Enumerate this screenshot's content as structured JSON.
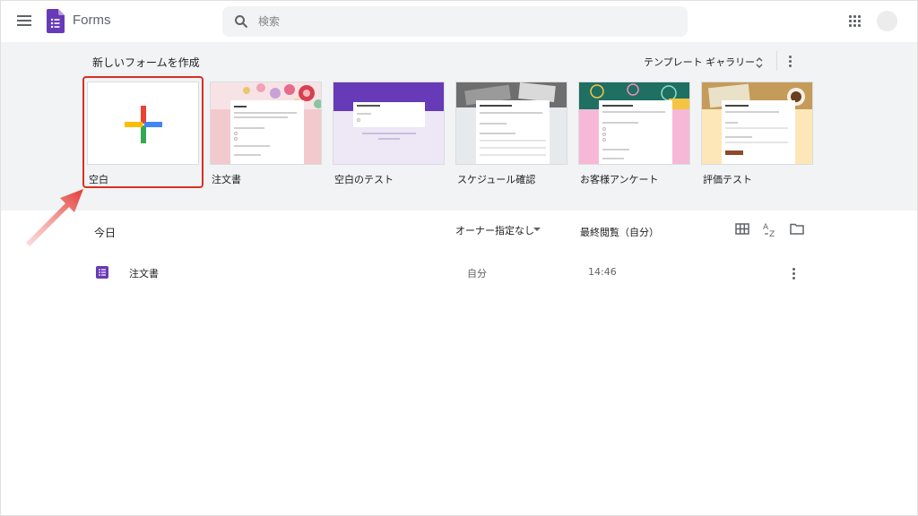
{
  "header": {
    "app_title": "Forms",
    "search_placeholder": "検索"
  },
  "templates": {
    "heading": "新しいフォームを作成",
    "gallery_label": "テンプレート ギャラリー",
    "items": [
      {
        "label": "空白"
      },
      {
        "label": "注文書"
      },
      {
        "label": "空白のテスト"
      },
      {
        "label": "スケジュール確認"
      },
      {
        "label": "お客様アンケート"
      },
      {
        "label": "評価テスト"
      }
    ]
  },
  "recent": {
    "heading": "今日",
    "owner_filter": "オーナー指定なし",
    "sort_label": "最終閲覧（自分）",
    "rows": [
      {
        "name": "注文書",
        "owner": "自分",
        "time": "14:46"
      }
    ]
  },
  "colors": {
    "forms_purple": "#673ab7",
    "highlight_red": "#d93025",
    "gallery_bg": "#f1f3f4"
  }
}
